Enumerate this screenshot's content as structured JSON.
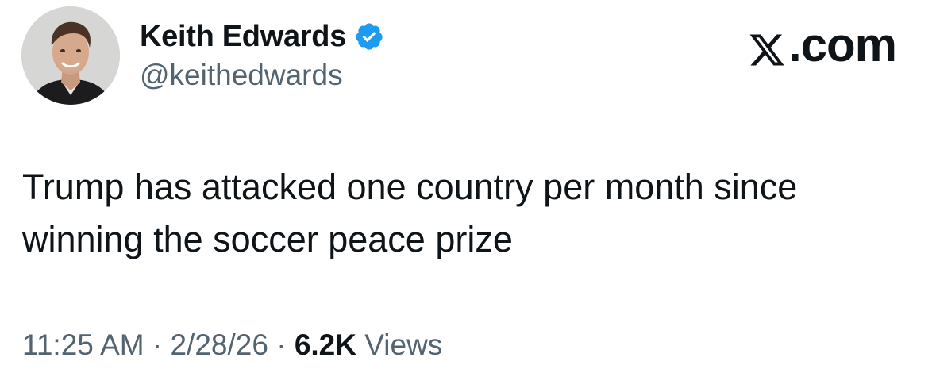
{
  "author": {
    "display_name": "Keith Edwards",
    "handle": "@keithedwards",
    "verified": true,
    "verified_color": "#1d9bf0"
  },
  "brand": {
    "label_suffix": ".com",
    "logo_icon": "x-logo-icon"
  },
  "tweet": {
    "text_lines": [
      "Trump has attacked one country per month since",
      "winning the soccer peace prize"
    ]
  },
  "meta": {
    "time": "11:25 AM",
    "separator": "·",
    "date": "2/28/26",
    "views_count": "6.2K",
    "views_label": "Views"
  },
  "colors": {
    "text_primary": "#0f1419",
    "text_secondary": "#536471"
  }
}
